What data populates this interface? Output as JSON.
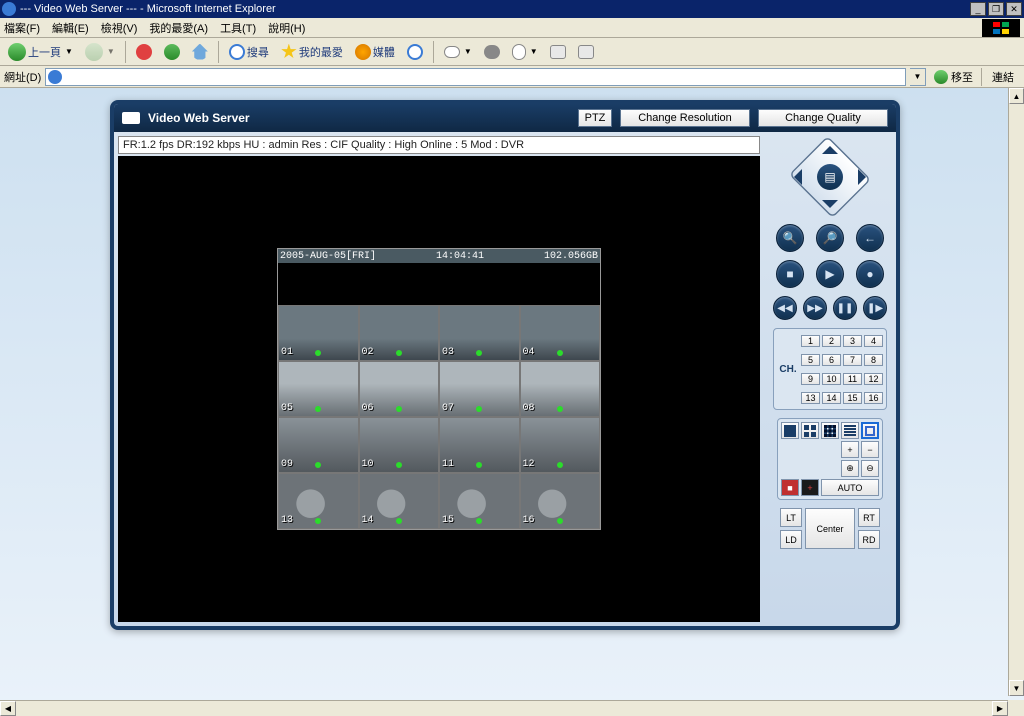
{
  "window": {
    "title": "--- Video Web Server --- - Microsoft Internet Explorer"
  },
  "menubar": {
    "file": "檔案(F)",
    "edit": "編輯(E)",
    "view": "檢視(V)",
    "favorites": "我的最愛(A)",
    "tools": "工具(T)",
    "help": "說明(H)"
  },
  "toolbar": {
    "back": "上一頁",
    "search": "搜尋",
    "favorites": "我的最愛",
    "media": "媒體"
  },
  "addressbar": {
    "label": "網址(D)",
    "go": "移至",
    "links": "連結"
  },
  "panel": {
    "title": "Video Web Server",
    "ptz": "PTZ",
    "change_res": "Change Resolution",
    "change_q": "Change Quality"
  },
  "status": {
    "text": "FR:1.2 fps  DR:192 kbps  HU : admin  Res : CIF  Quality : High  Online : 5 Mod : DVR"
  },
  "osd": {
    "date": "2005-AUG-05[FRI]",
    "time": "14:04:41",
    "size": "102.056GB"
  },
  "channels": {
    "label": "CH.",
    "list": [
      "1",
      "2",
      "3",
      "4",
      "5",
      "6",
      "7",
      "8",
      "9",
      "10",
      "11",
      "12",
      "13",
      "14",
      "15",
      "16"
    ]
  },
  "cams": [
    "01",
    "02",
    "03",
    "04",
    "05",
    "06",
    "07",
    "08",
    "09",
    "10",
    "11",
    "12",
    "13",
    "14",
    "15",
    "16"
  ],
  "layout": {
    "plus": "+",
    "minus": "−",
    "plusplus": "++",
    "minusminus": "−−",
    "auto": "AUTO"
  },
  "pos": {
    "lt": "LT",
    "rt": "RT",
    "ld": "LD",
    "rd": "RD",
    "center": "Center"
  }
}
